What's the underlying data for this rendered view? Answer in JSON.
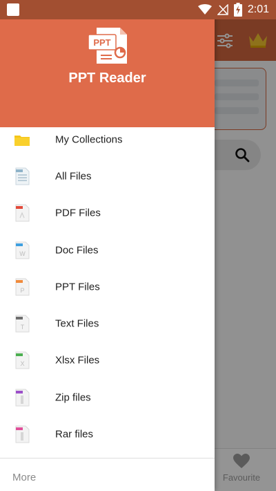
{
  "status_bar": {
    "time": "2:01"
  },
  "drawer": {
    "app_name": "PPT Reader",
    "logo_text": "PPT",
    "menu_items": [
      {
        "label": "My Collections",
        "icon": "folder-icon",
        "color": "#f5c518"
      },
      {
        "label": "All Files",
        "icon": "all-files-icon",
        "color": "#8fb3c9"
      },
      {
        "label": "PDF Files",
        "icon": "pdf-file-icon",
        "color": "#e34a3b"
      },
      {
        "label": "Doc Files",
        "icon": "doc-file-icon",
        "color": "#3fa0e0"
      },
      {
        "label": "PPT Files",
        "icon": "ppt-file-icon",
        "color": "#f08a3c"
      },
      {
        "label": "Text Files",
        "icon": "text-file-icon",
        "color": "#6e6e6e"
      },
      {
        "label": "Xlsx Files",
        "icon": "xlsx-file-icon",
        "color": "#4caf50"
      },
      {
        "label": "Zip files",
        "icon": "zip-file-icon",
        "color": "#9c4fc9"
      },
      {
        "label": "Rar files",
        "icon": "rar-file-icon",
        "color": "#e0509a"
      }
    ],
    "more_label": "More"
  },
  "background": {
    "bottom_nav": {
      "favourite_label": "Favourite"
    }
  },
  "colors": {
    "status_bar": "#a24f31",
    "header": "#df6b4a",
    "toolbar": "#d2673f"
  }
}
